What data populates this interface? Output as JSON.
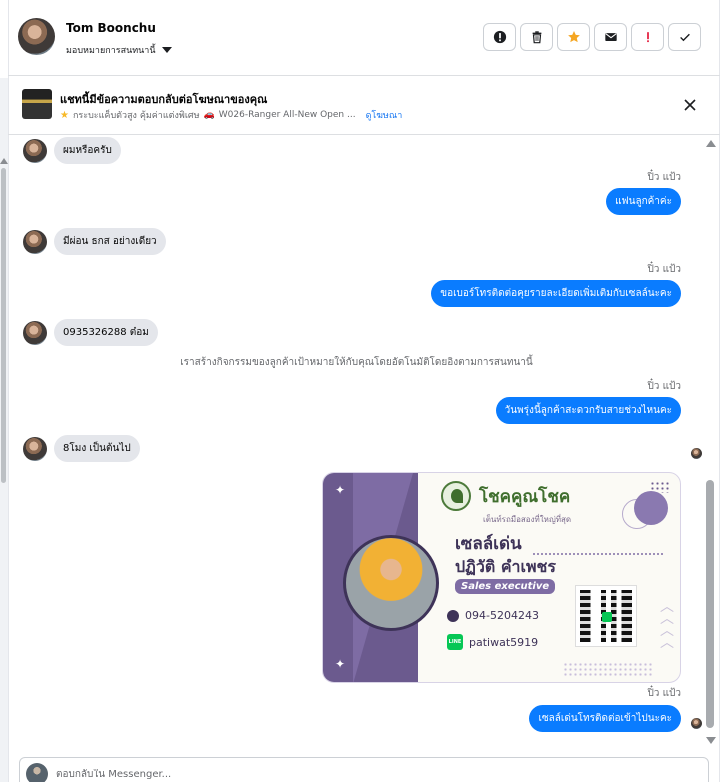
{
  "header": {
    "contact_name": "Tom Boonchu",
    "assign_label": "มอบหมายการสนทนานี้",
    "actions": [
      {
        "icon": "exclamation-circle-icon"
      },
      {
        "icon": "trash-icon"
      },
      {
        "icon": "star-icon",
        "color": "#f5a623"
      },
      {
        "icon": "envelope-icon"
      },
      {
        "icon": "exclamation-icon",
        "color": "#e41e3f"
      },
      {
        "icon": "check-icon"
      }
    ]
  },
  "ad_banner": {
    "title": "แชทนี้มีข้อความตอบกลับต่อโฆษณาของคุณ",
    "subtitle": "กระบะแค็บตัวสูง คุ้มค่าแต่งพิเศษ",
    "ad_name": "W026-Ranger All-New Open ...",
    "link_label": "ดูโฆษณา"
  },
  "conversation": {
    "messages": [
      {
        "direction": "in",
        "text": "ผมหรือครับ"
      },
      {
        "direction": "out",
        "sender": "ปิ๋ว แป้ว",
        "text": "แฟนลูกค้าค่ะ"
      },
      {
        "direction": "in",
        "text": "มีผ่อน ธกส อย่างเดียว"
      },
      {
        "direction": "out",
        "sender": "ปิ๋ว แป้ว",
        "text": "ขอเบอร์โทรติดต่อคุยรายละเอียดเพิ่มเติมกับเซลล์นะคะ"
      },
      {
        "direction": "in",
        "text": "0935326288 ต๋อม"
      },
      {
        "direction": "out",
        "sender": "ปิ๋ว แป้ว",
        "text": "วันพรุ่งนี้ลูกค้าสะดวกรับสายช่วงไหนคะ"
      },
      {
        "direction": "in",
        "text": "8โมง เป็นต้นไป"
      },
      {
        "direction": "out",
        "sender": "ปิ๋ว แป้ว",
        "text": "เซลล์เด่นโทรติดต่อเข้าไปนะคะ"
      }
    ],
    "system_note": "เราสร้างกิจกรรมของลูกค้าเป้าหมายให้กับคุณโดยอัตโนมัติโดยอิงตามการสนทนานี้"
  },
  "business_card": {
    "brand": "โชคคูณโชค",
    "tagline": "เต็นท์รถมือสองที่ใหญ่ที่สุด",
    "nickname": "เซลล์เด่น",
    "full_name": "ปฏิวัติ คำเพชร",
    "role": "Sales executive",
    "phone": "094-5204243",
    "line_id": "patiwat5919",
    "line_badge": "LINE"
  },
  "reply": {
    "placeholder": "ตอบกลับใน Messenger..."
  }
}
